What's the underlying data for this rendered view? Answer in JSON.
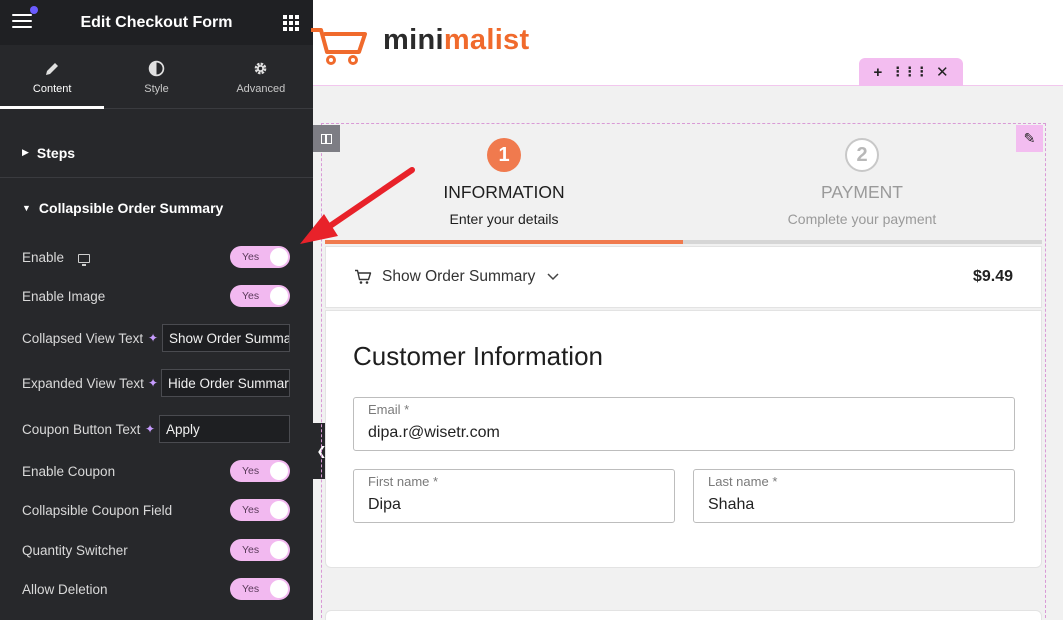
{
  "sidebar": {
    "title": "Edit Checkout Form",
    "tabs": [
      {
        "label": "Content",
        "icon": "pencil-icon",
        "active": true
      },
      {
        "label": "Style",
        "icon": "contrast-icon",
        "active": false
      },
      {
        "label": "Advanced",
        "icon": "gear-icon",
        "active": false
      }
    ],
    "sections": {
      "steps": "Steps",
      "collapsible": "Collapsible Order Summary"
    },
    "controls": {
      "enable": {
        "label": "Enable",
        "value": "Yes"
      },
      "enable_image": {
        "label": "Enable Image",
        "value": "Yes"
      },
      "collapsed_text": {
        "label": "Collapsed View Text",
        "value": "Show Order Summary"
      },
      "expanded_text": {
        "label": "Expanded View Text",
        "value": "Hide Order Summary"
      },
      "coupon_button": {
        "label": "Coupon Button Text",
        "value": "Apply"
      },
      "enable_coupon": {
        "label": "Enable Coupon",
        "value": "Yes"
      },
      "collapsible_coupon": {
        "label": "Collapsible Coupon Field",
        "value": "Yes"
      },
      "quantity_switcher": {
        "label": "Quantity Switcher",
        "value": "Yes"
      },
      "allow_deletion": {
        "label": "Allow Deletion",
        "value": "Yes"
      }
    }
  },
  "site": {
    "logo_part1": "mini",
    "logo_part2": "malist"
  },
  "checkout": {
    "steps": [
      {
        "number": "1",
        "title": "INFORMATION",
        "subtitle": "Enter your details"
      },
      {
        "number": "2",
        "title": "PAYMENT",
        "subtitle": "Complete your payment"
      }
    ],
    "summary": {
      "label": "Show Order Summary",
      "price": "$9.49"
    },
    "customer": {
      "title": "Customer Information",
      "email": {
        "label": "Email *",
        "value": "dipa.r@wisetr.com"
      },
      "first_name": {
        "label": "First name *",
        "value": "Dipa"
      },
      "last_name": {
        "label": "Last name *",
        "value": "Shaha"
      }
    }
  },
  "colors": {
    "accent": "#f07a4e",
    "toggle_on": "#f2b9f0",
    "sidebar_bg": "#27282b",
    "annotation_arrow": "#e8222a"
  }
}
